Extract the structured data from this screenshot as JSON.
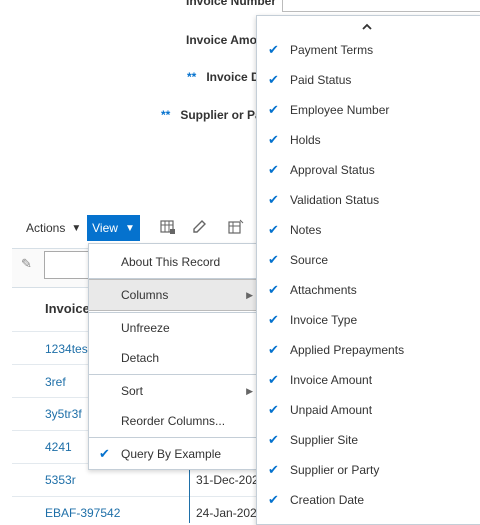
{
  "form": {
    "invoice_number_label": "Invoice Number",
    "invoice_amount_label": "Invoice Amo",
    "invoice_date_label": "Invoice D",
    "supplier_label": "Supplier or Pa",
    "required_marker": "**"
  },
  "toolbar": {
    "actions_label": "Actions",
    "view_label": "View",
    "caret": "▼"
  },
  "table": {
    "header": "Invoice",
    "invoice_links": [
      "1234tes",
      "3ref",
      "3y5tr3f",
      "4241",
      "5353r",
      "EBAF-397542"
    ],
    "dates": [
      "31-Dec-202",
      "24-Jan-202"
    ]
  },
  "view_menu": {
    "items": [
      {
        "label": "About This Record"
      },
      {
        "label": "Columns",
        "submenu": true,
        "active": true
      },
      {
        "label": "Unfreeze"
      },
      {
        "label": "Detach"
      },
      {
        "label": "Sort",
        "submenu": true
      },
      {
        "label": "Reorder Columns..."
      },
      {
        "label": "Query By Example",
        "checked": true
      }
    ]
  },
  "columns_menu": {
    "scroll_up": "⌃",
    "items": [
      "Payment Terms",
      "Paid Status",
      "Employee Number",
      "Holds",
      "Approval Status",
      "Validation Status",
      "Notes",
      "Source",
      "Attachments",
      "Invoice Type",
      "Applied Prepayments",
      "Invoice Amount",
      "Unpaid Amount",
      "Supplier Site",
      "Supplier or Party",
      "Creation Date"
    ]
  },
  "colors": {
    "accent": "#0572ce",
    "link": "#1e6fa8"
  }
}
